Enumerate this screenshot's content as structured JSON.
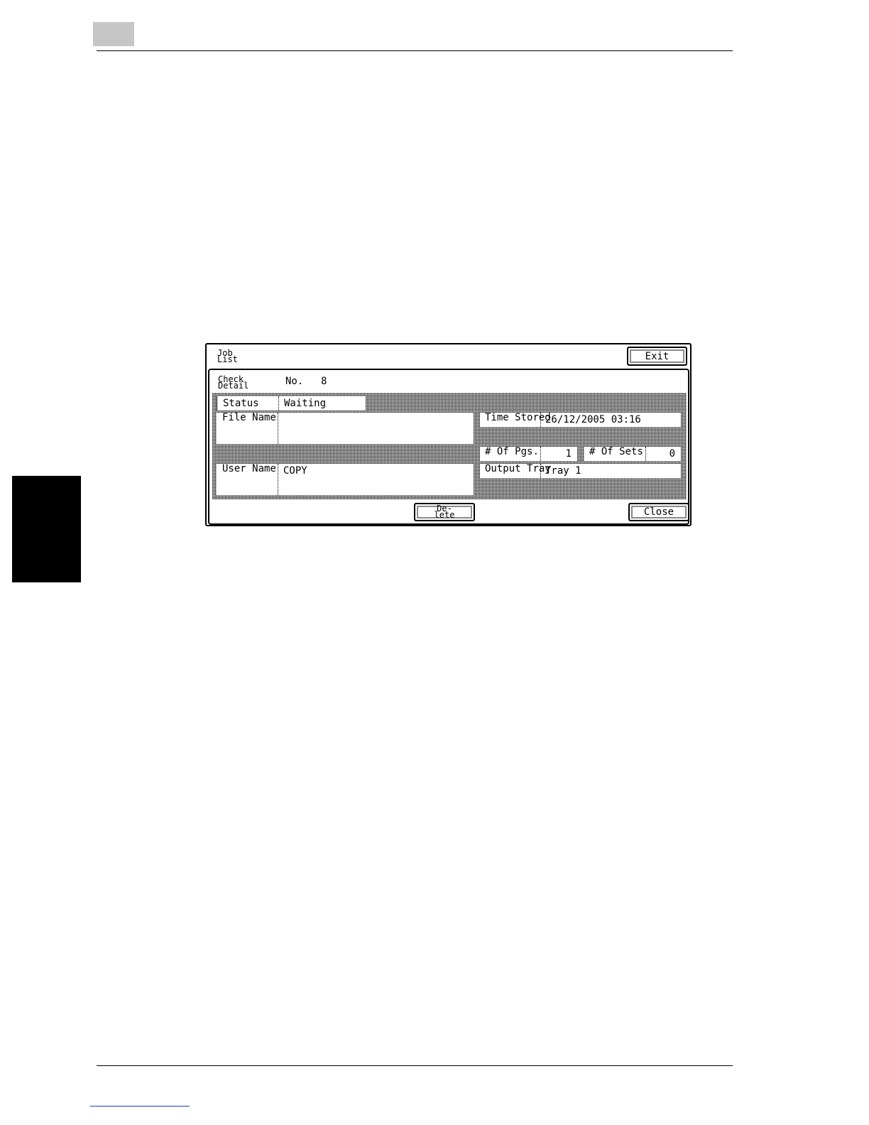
{
  "screen": {
    "title_line1": "Job",
    "title_line2": "List",
    "exit_label": "Exit",
    "check_line1": "Check",
    "check_line2": "Detail",
    "no_label": "No.",
    "no_value": "8",
    "status": {
      "label": "Status",
      "value": "Waiting"
    },
    "file_name": {
      "label_line1": "File",
      "label_line2": "Name",
      "value": ""
    },
    "time_stored": {
      "label_line1": "Time",
      "label_line2": "Stored",
      "value": "26/12/2005 03:16"
    },
    "num_pgs": {
      "label_line1": "# Of",
      "label_line2": "Pgs.",
      "value": "1"
    },
    "num_sets": {
      "label_line1": "# Of",
      "label_line2": "Sets",
      "value": "0"
    },
    "user_name": {
      "label_line1": "User",
      "label_line2": "Name",
      "value": "COPY"
    },
    "output_tray": {
      "label_line1": "Output",
      "label_line2": "Tray",
      "value": "Tray 1"
    },
    "delete_line1": "De-",
    "delete_line2": "lete",
    "close_label": "Close"
  },
  "colors": {
    "header_box": "#c6c6c6",
    "side_tab": "#000000",
    "footer_link": "#1b3fbf"
  }
}
